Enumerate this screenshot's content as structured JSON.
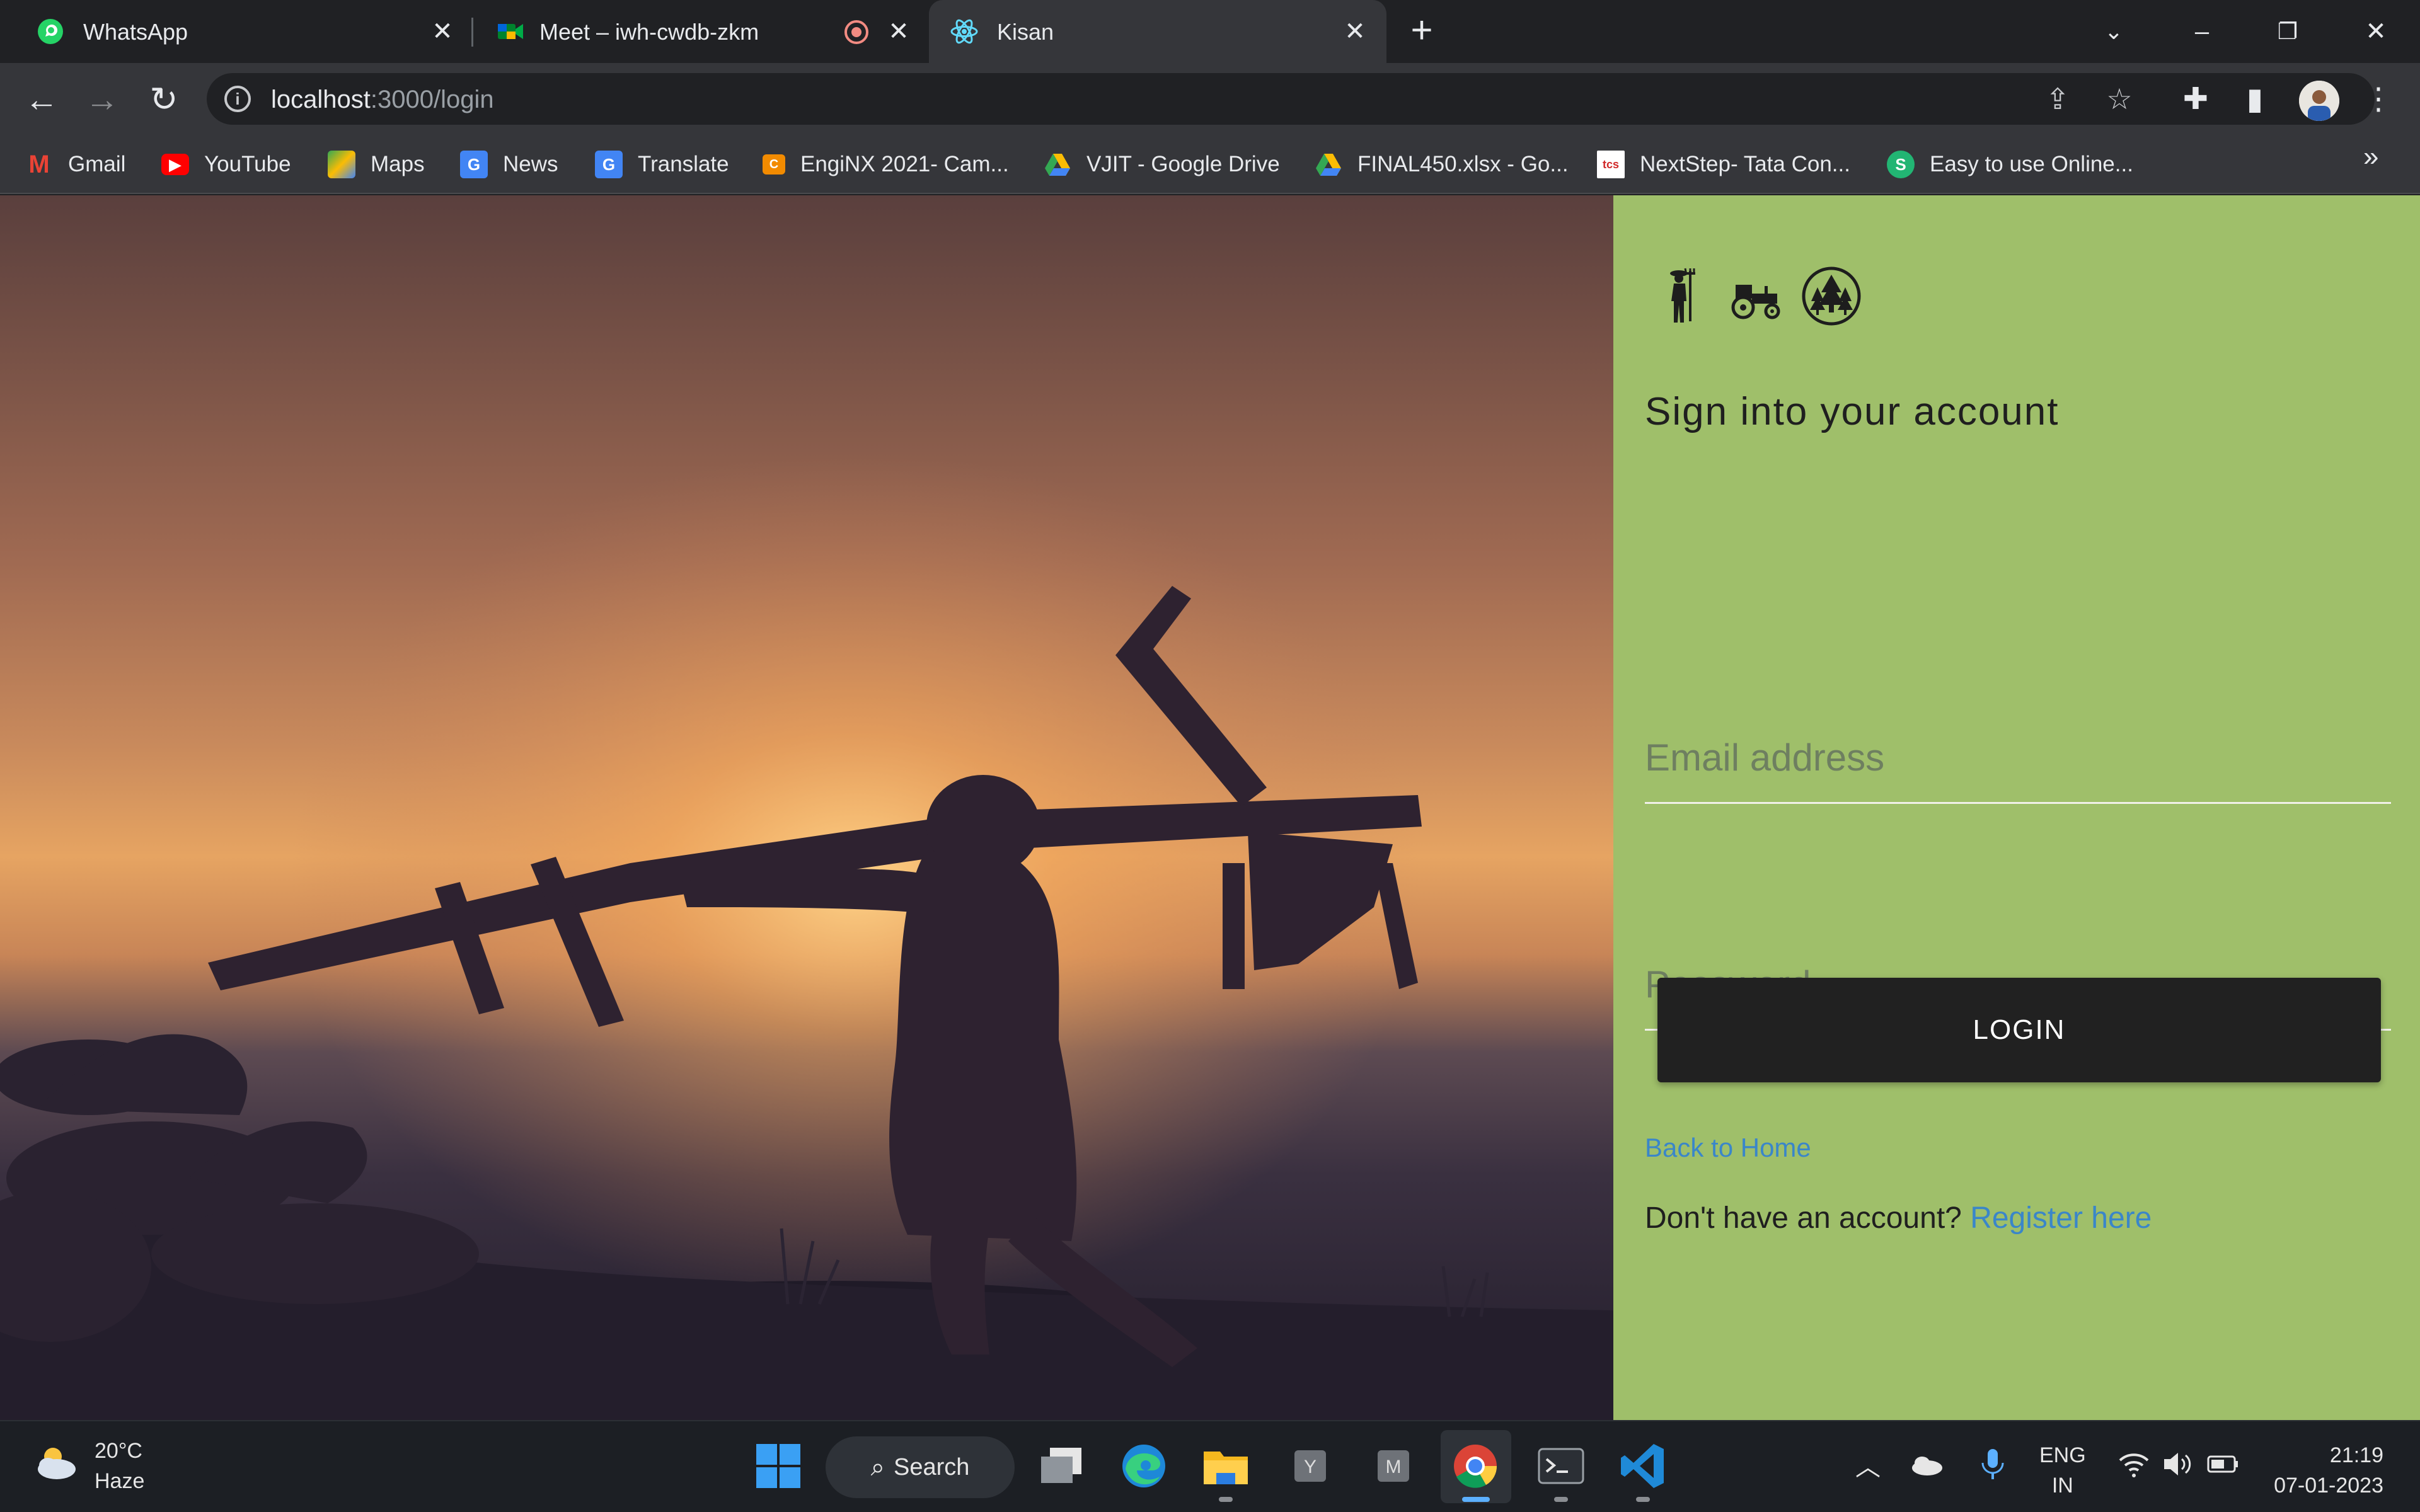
{
  "browser": {
    "tabs": [
      {
        "title": "WhatsApp",
        "active": false
      },
      {
        "title": "Meet – iwh-cwdb-zkm",
        "active": false,
        "recording": true
      },
      {
        "title": "Kisan",
        "active": true
      }
    ],
    "url_host": "localhost",
    "url_path": ":3000/login",
    "bookmarks": [
      {
        "label": "Gmail",
        "icon": "gmail-icon"
      },
      {
        "label": "YouTube",
        "icon": "youtube-icon"
      },
      {
        "label": "Maps",
        "icon": "maps-icon"
      },
      {
        "label": "News",
        "icon": "news-icon"
      },
      {
        "label": "Translate",
        "icon": "translate-icon"
      },
      {
        "label": "EngiNX 2021- Cam...",
        "icon": "enginx-icon"
      },
      {
        "label": "VJIT - Google Drive",
        "icon": "google-drive-icon"
      },
      {
        "label": "FINAL450.xlsx - Go...",
        "icon": "google-drive-icon"
      },
      {
        "label": "NextStep- Tata Con...",
        "icon": "tcs-icon"
      },
      {
        "label": "Easy to use Online...",
        "icon": "s-icon"
      }
    ],
    "bookmarks_overflow": "»"
  },
  "page": {
    "title": "Sign into your account",
    "email_placeholder": "Email address",
    "password_placeholder": "Password",
    "login_label": "LOGIN",
    "back_home": "Back to Home",
    "no_account_text": "Don't have an account? ",
    "register_link": "Register here",
    "panel_color": "#9fbf6a",
    "logos": [
      "farmer-icon",
      "tractor-icon",
      "forest-icon"
    ]
  },
  "taskbar": {
    "weather_temp": "20°C",
    "weather_desc": "Haze",
    "search_label": "Search",
    "lang_line1": "ENG",
    "lang_line2": "IN",
    "time": "21:19",
    "date": "07-01-2023",
    "apps": [
      "start-icon",
      "task-view-icon",
      "edge-icon",
      "file-explorer-icon",
      "y-app-icon",
      "m-app-icon",
      "chrome-icon",
      "terminal-icon",
      "vscode-icon"
    ]
  }
}
